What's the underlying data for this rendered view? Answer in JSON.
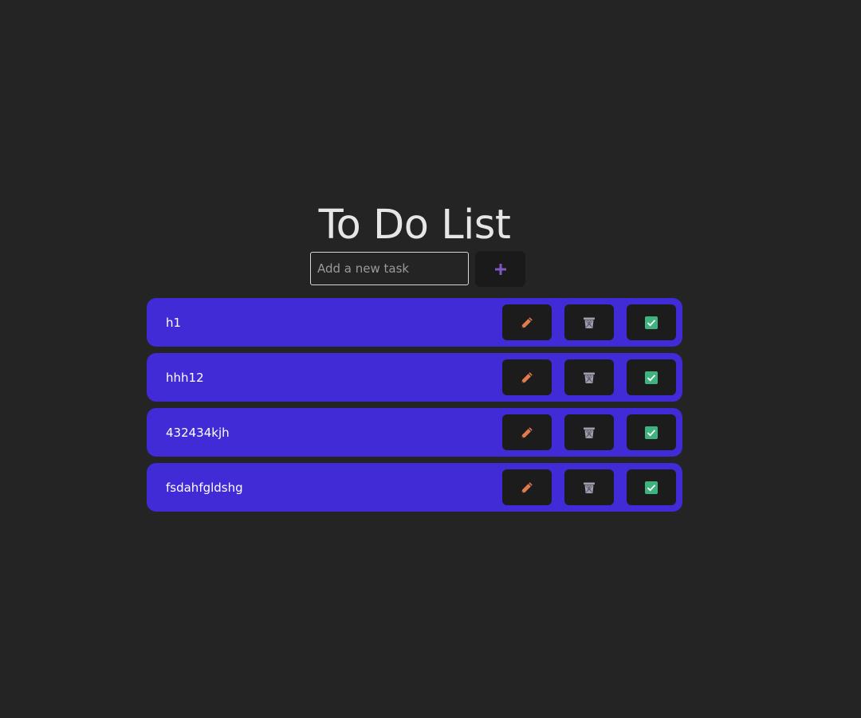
{
  "app": {
    "title": "To Do List"
  },
  "input": {
    "placeholder": "Add a new task",
    "value": ""
  },
  "add_button": {
    "icon": "plus-icon",
    "color": "#7e57c2"
  },
  "colors": {
    "background": "#242424",
    "item_background": "#412bd6",
    "button_background": "#1c1c1c",
    "edit_icon": "#e07a4f",
    "delete_icon": "#9e9eae",
    "complete_icon": "#3fb37f"
  },
  "todos": [
    {
      "text": "h1"
    },
    {
      "text": "hhh12"
    },
    {
      "text": "432434kjh"
    },
    {
      "text": "fsdahfgldshg"
    }
  ],
  "item_actions": [
    {
      "name": "edit",
      "icon": "pencil-icon"
    },
    {
      "name": "delete",
      "icon": "trash-icon"
    },
    {
      "name": "complete",
      "icon": "checkbox-icon"
    }
  ]
}
